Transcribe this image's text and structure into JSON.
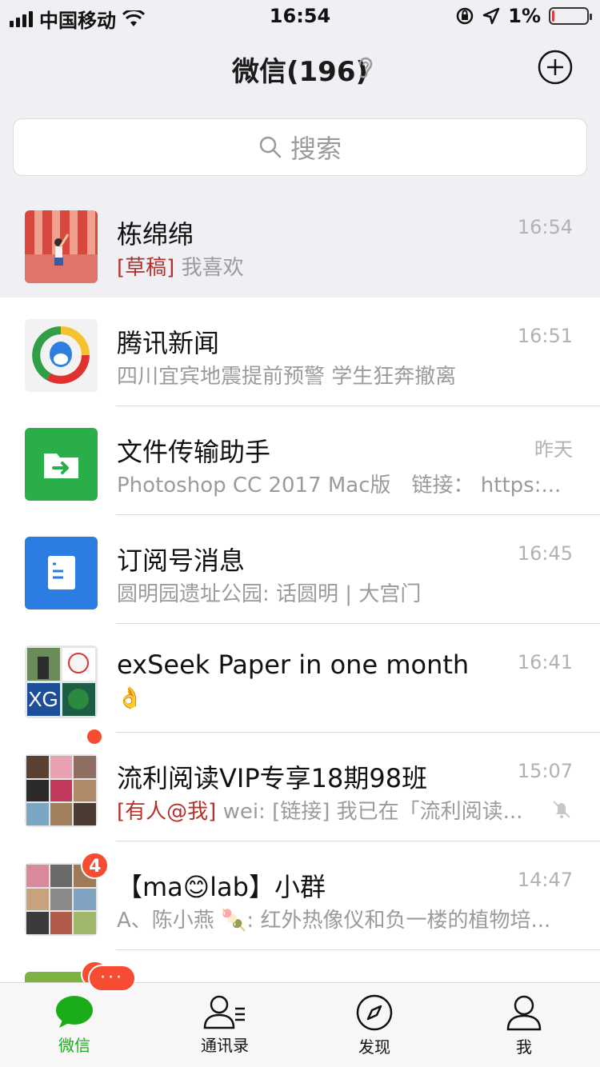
{
  "status": {
    "carrier": "中国移动",
    "time": "16:54",
    "battery": "1%"
  },
  "nav": {
    "title": "微信(196)"
  },
  "search": {
    "placeholder": "搜索"
  },
  "chats": [
    {
      "name": "栋绵绵",
      "time": "16:54",
      "tag": "[草稿]",
      "message": "我喜欢"
    },
    {
      "name": "腾讯新闻",
      "time": "16:51",
      "message": "四川宜宾地震提前预警 学生狂奔撤离"
    },
    {
      "name": "文件传输助手",
      "time": "昨天",
      "message": "Photoshop CC 2017 Mac版　链接： https:..."
    },
    {
      "name": "订阅号消息",
      "time": "16:45",
      "message": "圆明园遗址公园: 话圆明 | 大宫门"
    },
    {
      "name": "exSeek Paper in one month",
      "time": "16:41",
      "message": "👌"
    },
    {
      "name": "流利阅读VIP专享18期98班",
      "time": "15:07",
      "tag": "[有人@我]",
      "message": "wei: [链接] 我已在「流利阅读..."
    },
    {
      "name": "【ma😊lab】小群",
      "time": "14:47",
      "badge": "4",
      "message": "A、陈小燕 🍡: 红外热像仪和负一楼的植物培..."
    },
    {
      "name": "",
      "time": "",
      "badge": "4",
      "message": ""
    }
  ],
  "tabbar": {
    "dots": "···",
    "tabs": [
      {
        "label": "微信"
      },
      {
        "label": "通讯录"
      },
      {
        "label": "发现"
      },
      {
        "label": "我"
      }
    ]
  },
  "colors": {
    "accent": "#1aad19",
    "badge": "#f74c31",
    "draft": "#b6302a"
  }
}
